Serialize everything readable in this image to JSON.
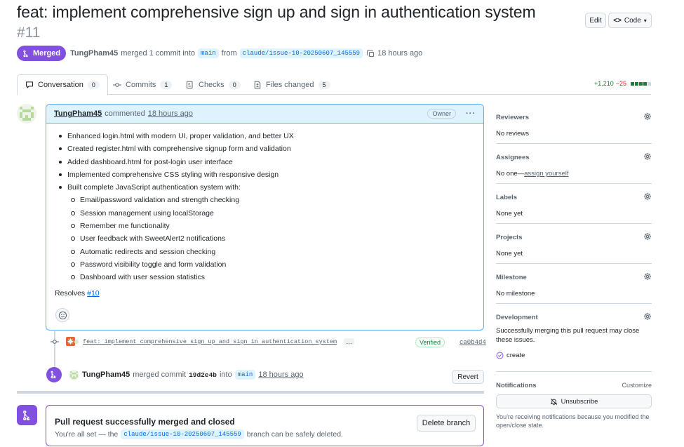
{
  "header": {
    "title": "feat: implement comprehensive sign up and sign in authentication system",
    "number": "#11",
    "edit_label": "Edit",
    "code_label": "Code",
    "state": "Merged",
    "author": "TungPham45",
    "merged_text": "merged 1 commit into",
    "base_branch": "main",
    "from_text": "from",
    "head_branch": "claude/issue-10-20250607_145559",
    "time": "18 hours ago"
  },
  "tabs": [
    {
      "label": "Conversation",
      "count": "0"
    },
    {
      "label": "Commits",
      "count": "1"
    },
    {
      "label": "Checks",
      "count": "0"
    },
    {
      "label": "Files changed",
      "count": "5"
    }
  ],
  "diffstat": {
    "additions": "+1,210",
    "deletions": "−25"
  },
  "comment": {
    "author": "TungPham45",
    "action": "commented",
    "time": "18 hours ago",
    "badge": "Owner",
    "items": [
      "Enhanced login.html with modern UI, proper validation, and better UX",
      "Created register.html with comprehensive signup form and validation",
      "Added dashboard.html for post-login user interface",
      "Implemented comprehensive CSS styling with responsive design",
      "Built complete JavaScript authentication system with:"
    ],
    "subitems": [
      "Email/password validation and strength checking",
      "Session management using localStorage",
      "Remember me functionality",
      "User feedback with SweetAlert2 notifications",
      "Automatic redirects and session checking",
      "Password visibility toggle and form validation",
      "Dashboard with user session statistics"
    ],
    "resolves_label": "Resolves",
    "resolves_link": "#10"
  },
  "commit": {
    "message": "feat: implement comprehensive sign up and sign in authentication system",
    "more": "…",
    "verified": "Verified",
    "sha": "ca0b4d4"
  },
  "merge_event": {
    "author": "TungPham45",
    "text": "merged commit",
    "sha": "19d2e4b",
    "into": "into",
    "branch": "main",
    "time": "18 hours ago",
    "revert_label": "Revert"
  },
  "merge_box": {
    "title": "Pull request successfully merged and closed",
    "sub_prefix": "You're all set — the",
    "branch": "claude/issue-10-20250607_145559",
    "sub_suffix": "branch can be safely deleted.",
    "delete_label": "Delete branch"
  },
  "sidebar": {
    "reviewers": {
      "title": "Reviewers",
      "value": "No reviews"
    },
    "assignees": {
      "title": "Assignees",
      "value": "No one—",
      "link": "assign yourself"
    },
    "labels": {
      "title": "Labels",
      "value": "None yet"
    },
    "projects": {
      "title": "Projects",
      "value": "None yet"
    },
    "milestone": {
      "title": "Milestone",
      "value": "No milestone"
    },
    "development": {
      "title": "Development",
      "value": "Successfully merging this pull request may close these issues.",
      "create": "create"
    },
    "notifications": {
      "title": "Notifications",
      "customize": "Customize",
      "unsubscribe": "Unsubscribe",
      "note": "You're receiving notifications because you modified the open/close state."
    }
  },
  "colors": {
    "merged": "#8250df",
    "link": "#0969da",
    "add": "#1a7f37",
    "del": "#cf222e"
  }
}
